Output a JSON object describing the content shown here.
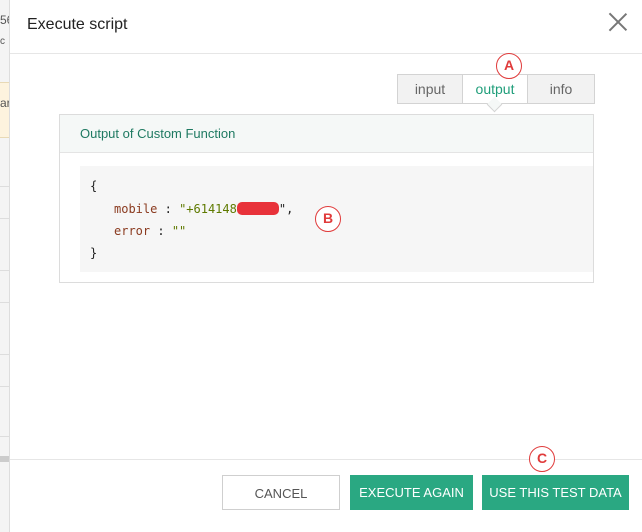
{
  "background": {
    "fragments": [
      "56",
      "c",
      "ar"
    ]
  },
  "modal": {
    "title": "Execute script"
  },
  "tabs": [
    {
      "label": "input",
      "active": false
    },
    {
      "label": "output",
      "active": true
    },
    {
      "label": "info",
      "active": false
    }
  ],
  "markers": {
    "a": "A",
    "b": "B",
    "c": "C"
  },
  "panel": {
    "heading": "Output of Custom Function",
    "code": {
      "open_brace": "{",
      "mobile_key": "mobile",
      "mobile_value_prefix": "\"+614148",
      "mobile_value_suffix": "\",",
      "error_key": "error",
      "error_value": "\"\"",
      "separator": ":",
      "close_brace": "}"
    }
  },
  "footer": {
    "cancel_label": "CANCEL",
    "execute_again_label": "EXECUTE AGAIN",
    "use_test_data_label": "USE THIS TEST DATA"
  },
  "colors": {
    "accent": "#2aa882",
    "annotation": "#e03b3b",
    "redaction": "#e8323a"
  }
}
